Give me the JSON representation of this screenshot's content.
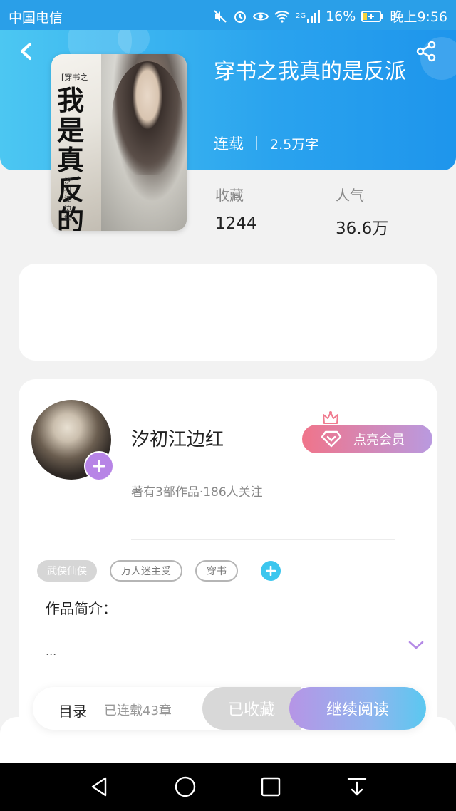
{
  "status_bar": {
    "carrier": "中国电信",
    "network": "2G",
    "battery": "16%",
    "time": "晚上9:56"
  },
  "header": {
    "back_icon": "chevron-left-icon",
    "share_icon": "share-icon",
    "colors": {
      "gradient_start": "#4cc7f2",
      "gradient_end": "#1e95ec"
    }
  },
  "book": {
    "title": "穿书之我真的是反派",
    "status": "连载",
    "word_count": "2.5万字",
    "cover": {
      "small_label": "[穿书之",
      "title_art": "我是真反的派",
      "author_art": "汐初江边红"
    },
    "stats": [
      {
        "label": "收藏",
        "value": "1244"
      },
      {
        "label": "人气",
        "value": "36.6万"
      }
    ]
  },
  "author": {
    "name": "汐初江边红",
    "info": "著有3部作品·186人关注",
    "vip_button": "点亮会员",
    "vip_colors": {
      "start": "#f0748a",
      "end": "#b99ae0"
    }
  },
  "tags": [
    "武侠仙侠",
    "万人迷主受",
    "穿书"
  ],
  "intro": {
    "label": "作品简介：",
    "text": "..."
  },
  "bottom_bar": {
    "toc_label": "目录",
    "chapters": "已连载43章",
    "collected_label": "已收藏",
    "continue_label": "继续阅读"
  },
  "nav": {
    "back": "triangle-back-icon",
    "home": "circle-home-icon",
    "recents": "square-recents-icon",
    "notifications": "pull-down-icon"
  }
}
